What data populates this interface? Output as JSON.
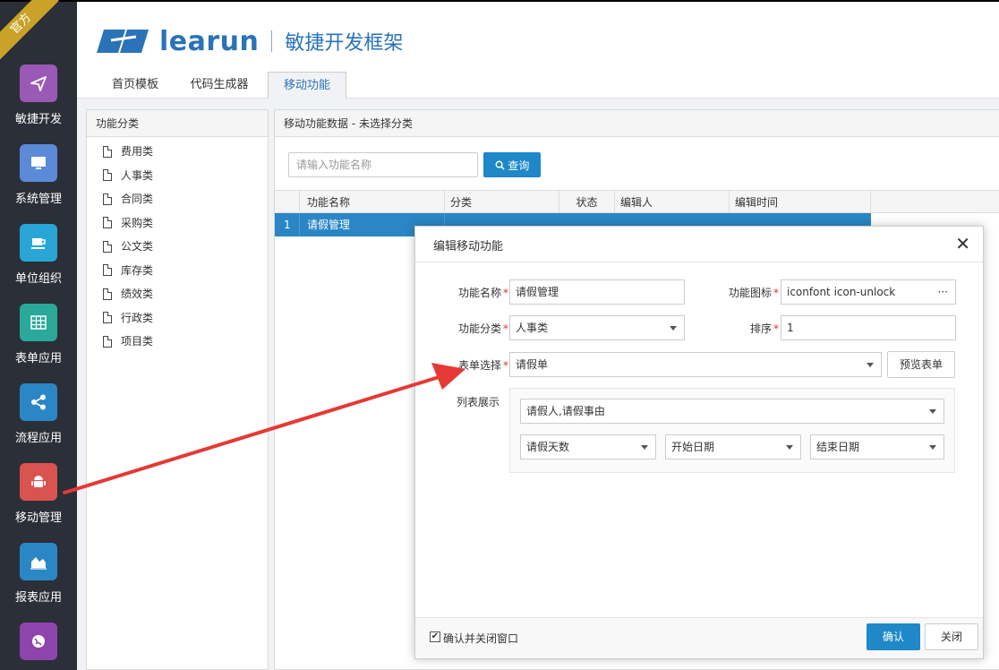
{
  "sidebar": {
    "ribbon": "官方",
    "items": [
      {
        "label": "敏捷开发",
        "icon": "paper-plane-icon",
        "color": "#9b59b6",
        "glyph": "✈"
      },
      {
        "label": "系统管理",
        "icon": "monitor-icon",
        "color": "#5b8ad6",
        "glyph": "▭"
      },
      {
        "label": "单位组织",
        "icon": "coffee-icon",
        "color": "#2aa6d6",
        "glyph": "☕"
      },
      {
        "label": "表单应用",
        "icon": "table-icon",
        "color": "#2aa89a",
        "glyph": "▦"
      },
      {
        "label": "流程应用",
        "icon": "share-icon",
        "color": "#2a86c5",
        "glyph": "≺"
      },
      {
        "label": "移动管理",
        "icon": "android-icon",
        "color": "#d9534f",
        "glyph": "☗"
      },
      {
        "label": "报表应用",
        "icon": "area-chart-icon",
        "color": "#2a86c5",
        "glyph": "◭"
      },
      {
        "label": "",
        "icon": "globe-icon",
        "color": "#8e44ad",
        "glyph": "●"
      }
    ]
  },
  "header": {
    "brand": "learun",
    "subtitle": "敏捷开发框架"
  },
  "tabs": [
    {
      "label": "首页模板"
    },
    {
      "label": "代码生成器"
    },
    {
      "label": "移动功能"
    }
  ],
  "left_panel": {
    "title": "功能分类",
    "items": [
      "费用类",
      "人事类",
      "合同类",
      "采购类",
      "公文类",
      "库存类",
      "绩效类",
      "行政类",
      "项目类"
    ]
  },
  "right_panel": {
    "title": "移动功能数据 - 未选择分类",
    "search_placeholder": "请输入功能名称",
    "search_button": "查询",
    "columns": [
      "功能名称",
      "分类",
      "状态",
      "编辑人",
      "编辑时间"
    ],
    "rows": [
      {
        "index": "1",
        "name": "请假管理"
      }
    ]
  },
  "dialog": {
    "title": "编辑移动功能",
    "fields": {
      "name_label": "功能名称",
      "name_value": "请假管理",
      "icon_label": "功能图标",
      "icon_value": "iconfont icon-unlock",
      "icon_more": "···",
      "category_label": "功能分类",
      "category_value": "人事类",
      "sort_label": "排序",
      "sort_value": "1",
      "form_label": "表单选择",
      "form_value": "请假单",
      "preview_button": "预览表单",
      "list_label": "列表展示",
      "list_columns": "请假人,请假事由",
      "list_col1": "请假天数",
      "list_col2": "开始日期",
      "list_col3": "结束日期"
    },
    "footer": {
      "checkbox_label": "确认并关闭窗口",
      "checked": true,
      "ok_button": "确认",
      "close_button": "关闭"
    }
  },
  "colors": {
    "accent": "#1e88c8",
    "sidebar_bg": "#2b2f38",
    "required": "#e03030",
    "arrow": "#e53935"
  }
}
